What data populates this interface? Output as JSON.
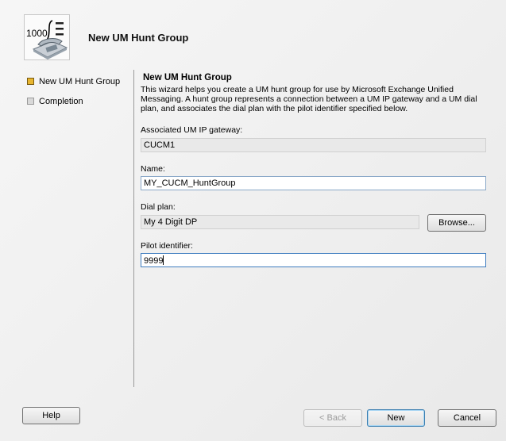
{
  "window": {
    "title": "New UM Hunt Group"
  },
  "icon": {
    "name": "um-hunt-group-icon",
    "label": "1000"
  },
  "steps": [
    {
      "label": "New UM Hunt Group",
      "state": "active"
    },
    {
      "label": "Completion",
      "state": "inactive"
    }
  ],
  "page": {
    "section_title": "New UM Hunt Group",
    "description": "This wizard helps you create a UM hunt group for use by Microsoft Exchange Unified Messaging. A hunt group represents a connection between a UM IP gateway and a UM dial plan, and associates the dial plan with the pilot identifier specified below."
  },
  "form": {
    "gateway_label": "Associated UM IP gateway:",
    "gateway_value": "CUCM1",
    "name_label": "Name:",
    "name_value": "MY_CUCM_HuntGroup",
    "dialplan_label": "Dial plan:",
    "dialplan_value": "My 4 Digit DP",
    "browse_label": "Browse...",
    "pilot_label": "Pilot identifier:",
    "pilot_value": "9999"
  },
  "buttons": {
    "help": "Help",
    "back": "< Back",
    "new": "New",
    "cancel": "Cancel"
  },
  "colors": {
    "active_step": "#e7b530",
    "focus_border": "#3e7cbf"
  }
}
